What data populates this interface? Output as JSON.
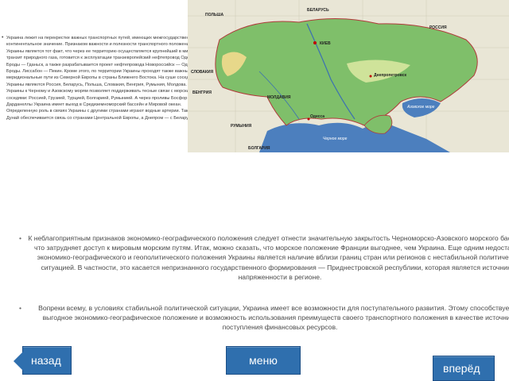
{
  "text_block_1": "Украина лежит на перекрестке важных транспортных путей, имеющих межгосударственное и континентальное значение. Признаком важности и полезности транспортного положения Украины является тот факт, что через ее территорию осуществляется крупнейший в мире транзит природного газа, готовится к эксплуатации транзевропейский нефтепровод Одесса — Броды — Гданьск, а также разрабатывается проект нефтепровода Новороссийск — Одесса — Броды. Лиссабон — Пекин. Кроме этого, по территории Украины проходят также важны меридиональные пути из Северной Европы в страны Ближнего Востока. На суше соседями Украины являются Россия, Беларусь, Польша, Словакия, Венгрия, Румыния, Молдова. Выход Украины к Черному и Азовскому морям позволяет поддерживать тесные связи с морскими соседями: Россией, Грузией, Турцией, Болгарией, Румынией. А через проливы Босфор и Дарданеллы Украина имеет выход в Средиземноморский бассейн и Мировой океан. Определенную роль в связях Украины с другими странами играют водные артерии. Так, через Дунай обеспечивается связь со странами Центральной Европы, а Днепром — с Беларусью.",
  "text_block_2": "К неблагоприятным признаков экономико-географического положения следует отнести значительную закрытость Черноморско-Азовского морского бассейна, что затрудняет доступ к мировым морским путям. Итак, можно сказать, что морское положение Франции выгоднее, чем Украина. Еще одним недостатком экономико-географического и геополитического положения Украины является наличие вблизи границ стран или регионов с нестабильной политической ситуацией. В частности, это касается непризнанного государственного формирования — Приднестровской республики, которая является источником напряженности в регионе.",
  "text_block_3": "Вопреки всему, в условиях стабильной политической ситуации, Украина имеет все возможности для поступательного развития. Этому способствует ее выгодное экономико-географическое положение и возможность использования преимуществ своего транспортного положения в качестве источника поступления финансовых ресурсов.",
  "map": {
    "labels": {
      "poland": "ПОЛЬША",
      "belarus": "БЕЛАРУСЬ",
      "russia": "РОССИЯ",
      "kiev": "КИЕВ",
      "slovakia": "СЛОВАКИЯ",
      "hungary": "ВЕНГРИЯ",
      "moldova": "МОЛДАВИЯ",
      "romania": "РУМЫНИЯ",
      "bulgaria": "БОЛГАРИЯ",
      "odessa": "Одесса",
      "dnepropetrovsk": "Днепропетровск",
      "black_sea": "Черное море",
      "azov_sea": "Азовское море"
    },
    "colors": {
      "sea": "#4c7fbe",
      "land_low": "#7fbf6a",
      "land_high": "#e7d88a",
      "neighbors": "#e9e6d6"
    }
  },
  "nav": {
    "back_label": "назад",
    "menu_label": "меню",
    "next_label": "вперёд"
  },
  "colors": {
    "button": "#2f6fae",
    "text": "#4a4a4a"
  }
}
